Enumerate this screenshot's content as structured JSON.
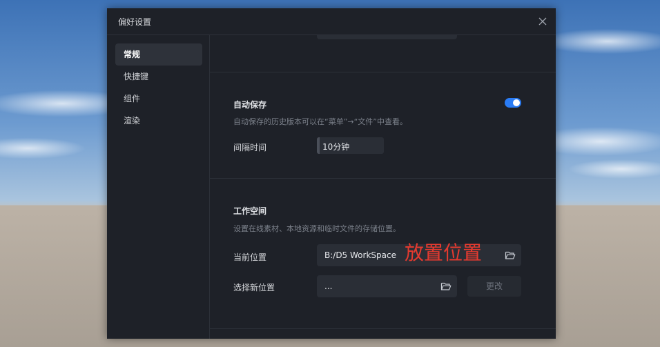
{
  "dialog": {
    "title": "偏好设置"
  },
  "sidebar": {
    "items": [
      {
        "label": "常规",
        "active": true
      },
      {
        "label": "快捷键",
        "active": false
      },
      {
        "label": "组件",
        "active": false
      },
      {
        "label": "渲染",
        "active": false
      }
    ]
  },
  "autosave": {
    "title": "自动保存",
    "description": "自动保存的历史版本可以在“菜单”→“文件”中查看。",
    "enabled": true,
    "interval_label": "间隔时间",
    "interval_value": "10分钟"
  },
  "workspace": {
    "title": "工作空间",
    "description": "设置在线素材、本地资源和临时文件的存储位置。",
    "current_label": "当前位置",
    "current_value": "B:/D5 WorkSpace",
    "current_annotation": "放置位置",
    "new_label": "选择新位置",
    "new_value": "...",
    "change_button": "更改"
  },
  "icons": {
    "close": "close-icon",
    "folder": "folder-open-icon"
  },
  "colors": {
    "accent": "#2a7cf5",
    "dialog_bg": "#1e2128",
    "annotation": "#e53a2f"
  }
}
